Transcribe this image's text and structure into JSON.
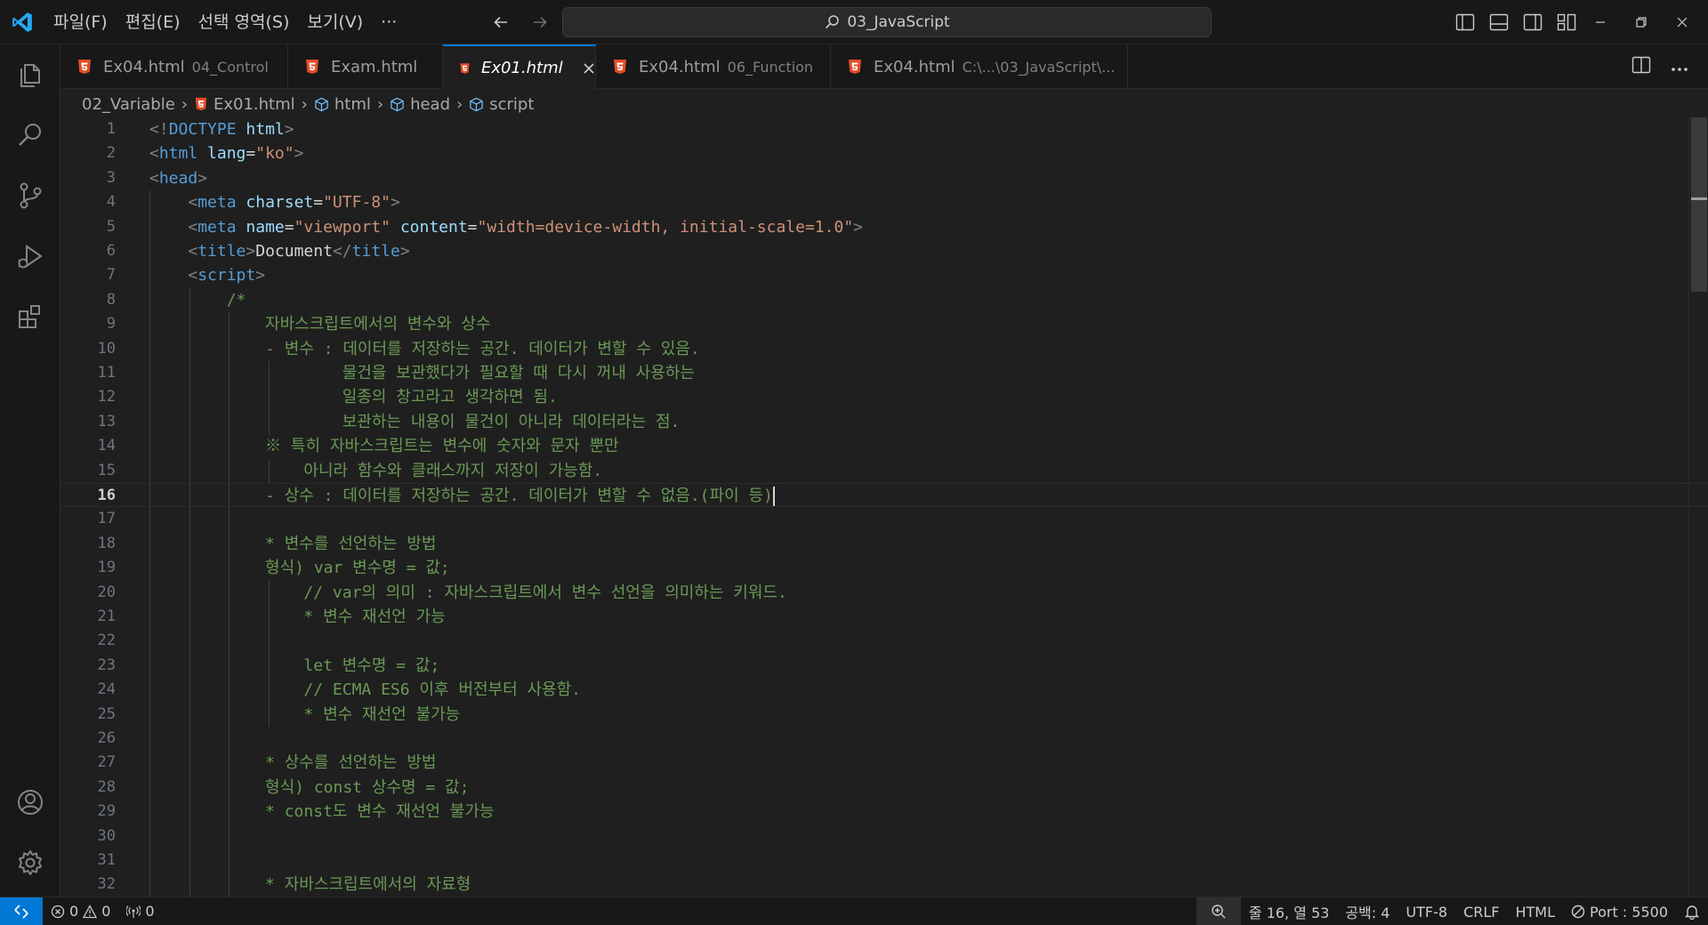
{
  "menu": [
    "파일(F)",
    "편집(E)",
    "선택 영역(S)",
    "보기(V)",
    "···"
  ],
  "search": {
    "text": "03_JavaScript"
  },
  "tabs": [
    {
      "name": "Ex04.html",
      "desc": "04_Control",
      "active": false
    },
    {
      "name": "Exam.html",
      "desc": "",
      "active": false
    },
    {
      "name": "Ex01.html",
      "desc": "",
      "active": true
    },
    {
      "name": "Ex04.html",
      "desc": "06_Function",
      "active": false
    },
    {
      "name": "Ex04.html",
      "desc": "C:\\...\\03_JavaScript\\...",
      "active": false
    }
  ],
  "breadcrumb": [
    "02_Variable",
    "Ex01.html",
    "html",
    "head",
    "script"
  ],
  "editor": {
    "current_line": 16,
    "lines": [
      {
        "n": "1",
        "tokens": [
          [
            "t-br",
            "<!"
          ],
          [
            "t-tag",
            "DOCTYPE "
          ],
          [
            "t-attr",
            "html"
          ],
          [
            "t-br",
            ">"
          ]
        ]
      },
      {
        "n": "2",
        "tokens": [
          [
            "t-br",
            "<"
          ],
          [
            "t-tag",
            "html "
          ],
          [
            "t-attr",
            "lang"
          ],
          [
            "t-text",
            "="
          ],
          [
            "t-str",
            "\"ko\""
          ],
          [
            "t-br",
            ">"
          ]
        ]
      },
      {
        "n": "3",
        "tokens": [
          [
            "t-br",
            "<"
          ],
          [
            "t-tag",
            "head"
          ],
          [
            "t-br",
            ">"
          ]
        ]
      },
      {
        "n": "4",
        "tokens": [
          [
            "t-text",
            "    "
          ],
          [
            "t-br",
            "<"
          ],
          [
            "t-tag",
            "meta "
          ],
          [
            "t-attr",
            "charset"
          ],
          [
            "t-text",
            "="
          ],
          [
            "t-str",
            "\"UTF-8\""
          ],
          [
            "t-br",
            ">"
          ]
        ]
      },
      {
        "n": "5",
        "tokens": [
          [
            "t-text",
            "    "
          ],
          [
            "t-br",
            "<"
          ],
          [
            "t-tag",
            "meta "
          ],
          [
            "t-attr",
            "name"
          ],
          [
            "t-text",
            "="
          ],
          [
            "t-str",
            "\"viewport\" "
          ],
          [
            "t-attr",
            "content"
          ],
          [
            "t-text",
            "="
          ],
          [
            "t-str",
            "\"width=device-width, initial-scale=1.0\""
          ],
          [
            "t-br",
            ">"
          ]
        ]
      },
      {
        "n": "6",
        "tokens": [
          [
            "t-text",
            "    "
          ],
          [
            "t-br",
            "<"
          ],
          [
            "t-tag",
            "title"
          ],
          [
            "t-br",
            ">"
          ],
          [
            "t-text",
            "Document"
          ],
          [
            "t-br",
            "</"
          ],
          [
            "t-tag",
            "title"
          ],
          [
            "t-br",
            ">"
          ]
        ]
      },
      {
        "n": "7",
        "tokens": [
          [
            "t-text",
            "    "
          ],
          [
            "t-br",
            "<"
          ],
          [
            "t-tag",
            "script"
          ],
          [
            "t-br",
            ">"
          ]
        ]
      },
      {
        "n": "8",
        "tokens": [
          [
            "t-com",
            "        /*"
          ]
        ]
      },
      {
        "n": "9",
        "tokens": [
          [
            "t-com",
            "            자바스크립트에서의 변수와 상수"
          ]
        ]
      },
      {
        "n": "10",
        "tokens": [
          [
            "t-com",
            "            - 변수 : 데이터를 저장하는 공간. 데이터가 변할 수 있음."
          ]
        ]
      },
      {
        "n": "11",
        "tokens": [
          [
            "t-com",
            "                    물건을 보관했다가 필요할 때 다시 꺼내 사용하는"
          ]
        ]
      },
      {
        "n": "12",
        "tokens": [
          [
            "t-com",
            "                    일종의 창고라고 생각하면 됨."
          ]
        ]
      },
      {
        "n": "13",
        "tokens": [
          [
            "t-com",
            "                    보관하는 내용이 물건이 아니라 데이터라는 점."
          ]
        ]
      },
      {
        "n": "14",
        "tokens": [
          [
            "t-com",
            "            ※ 특히 자바스크립트는 변수에 숫자와 문자 뿐만"
          ]
        ]
      },
      {
        "n": "15",
        "tokens": [
          [
            "t-com",
            "                아니라 함수와 클래스까지 저장이 가능함."
          ]
        ]
      },
      {
        "n": "16",
        "tokens": [
          [
            "t-com",
            "            - 상수 : 데이터를 저장하는 공간. 데이터가 변할 수 없음.(파이 등)"
          ]
        ]
      },
      {
        "n": "17",
        "tokens": []
      },
      {
        "n": "18",
        "tokens": [
          [
            "t-com",
            "            * 변수를 선언하는 방법"
          ]
        ]
      },
      {
        "n": "19",
        "tokens": [
          [
            "t-com",
            "            형식) var 변수명 = 값;"
          ]
        ]
      },
      {
        "n": "20",
        "tokens": [
          [
            "t-com",
            "                // var의 의미 : 자바스크립트에서 변수 선언을 의미하는 키워드."
          ]
        ]
      },
      {
        "n": "21",
        "tokens": [
          [
            "t-com",
            "                * 변수 재선언 가능"
          ]
        ]
      },
      {
        "n": "22",
        "tokens": []
      },
      {
        "n": "23",
        "tokens": [
          [
            "t-com",
            "                let 변수명 = 값;"
          ]
        ]
      },
      {
        "n": "24",
        "tokens": [
          [
            "t-com",
            "                // ECMA ES6 이후 버전부터 사용함."
          ]
        ]
      },
      {
        "n": "25",
        "tokens": [
          [
            "t-com",
            "                * 변수 재선언 불가능"
          ]
        ]
      },
      {
        "n": "26",
        "tokens": []
      },
      {
        "n": "27",
        "tokens": [
          [
            "t-com",
            "            * 상수를 선언하는 방법"
          ]
        ]
      },
      {
        "n": "28",
        "tokens": [
          [
            "t-com",
            "            형식) const 상수명 = 값;"
          ]
        ]
      },
      {
        "n": "29",
        "tokens": [
          [
            "t-com",
            "            * const도 변수 재선언 불가능"
          ]
        ]
      },
      {
        "n": "30",
        "tokens": []
      },
      {
        "n": "31",
        "tokens": []
      },
      {
        "n": "32",
        "tokens": [
          [
            "t-com",
            "            * 자바스크립트에서의 자료형"
          ]
        ]
      }
    ]
  },
  "status": {
    "errors": "0",
    "warnings": "0",
    "ports": "0",
    "position": "줄 16, 열 53",
    "spaces": "공백: 4",
    "encoding": "UTF-8",
    "eol": "CRLF",
    "language": "HTML",
    "port": "Port : 5500"
  },
  "colors": {
    "accent": "#0078d4",
    "html_icon": "#e44d26",
    "comment": "#6a9955",
    "tag": "#569cd6",
    "attr": "#9cdcfe",
    "string": "#ce9178"
  }
}
